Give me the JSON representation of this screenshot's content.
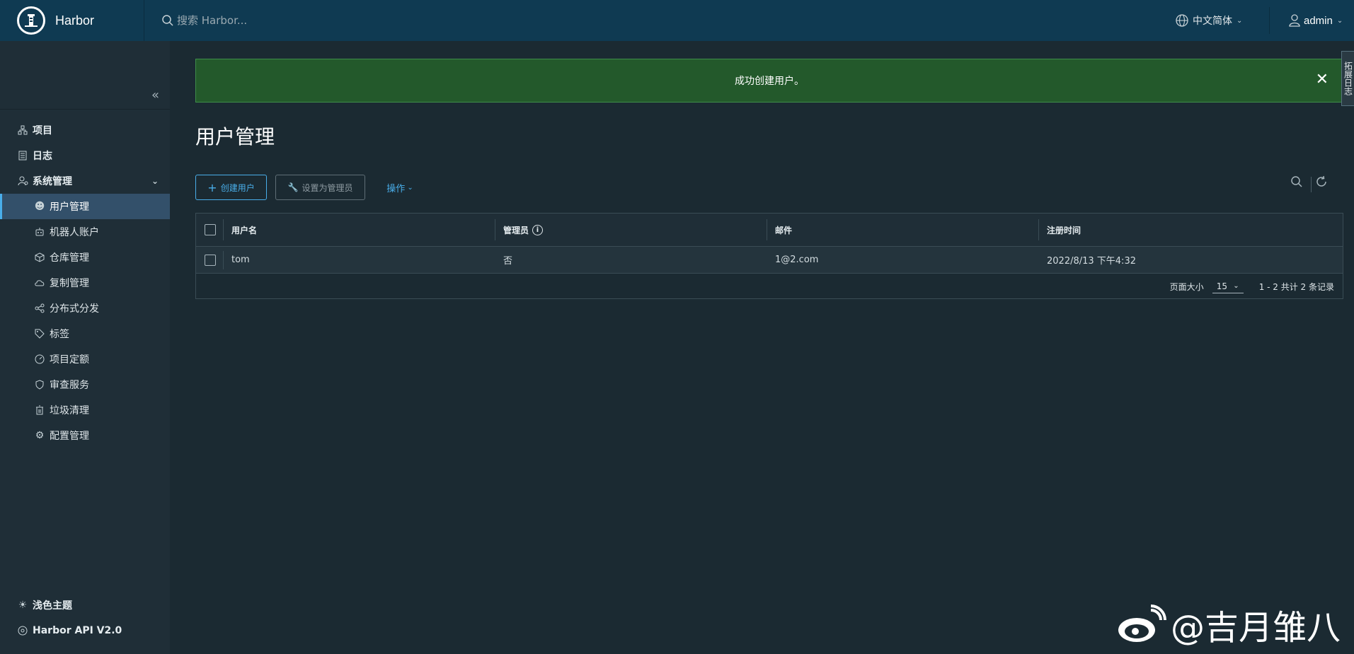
{
  "header": {
    "brand": "Harbor",
    "search_placeholder": "搜索 Harbor...",
    "language": "中文简体",
    "user": "admin"
  },
  "sidebar": {
    "items": [
      {
        "label": "项目",
        "icon": "project-icon"
      },
      {
        "label": "日志",
        "icon": "log-icon"
      },
      {
        "label": "系统管理",
        "icon": "admin-icon"
      }
    ],
    "sub_items": [
      {
        "label": "用户管理",
        "icon": "users-icon"
      },
      {
        "label": "机器人账户",
        "icon": "robot-icon"
      },
      {
        "label": "仓库管理",
        "icon": "box-icon"
      },
      {
        "label": "复制管理",
        "icon": "cloud-icon"
      },
      {
        "label": "分布式分发",
        "icon": "share-icon"
      },
      {
        "label": "标签",
        "icon": "tag-icon"
      },
      {
        "label": "项目定额",
        "icon": "dashboard-icon"
      },
      {
        "label": "审查服务",
        "icon": "shield-icon"
      },
      {
        "label": "垃圾清理",
        "icon": "trash-icon"
      },
      {
        "label": "配置管理",
        "icon": "gear-icon"
      }
    ],
    "footer": {
      "theme": "浅色主题",
      "api": "Harbor API V2.0"
    }
  },
  "alert": {
    "message": "成功创建用户。",
    "side_tab": "拓展日志"
  },
  "page": {
    "title": "用户管理"
  },
  "toolbar": {
    "create_label": "创建用户",
    "set_admin_label": "设置为管理员",
    "action_label": "操作"
  },
  "table": {
    "headers": [
      "用户名",
      "管理员",
      "邮件",
      "注册时间"
    ],
    "rows": [
      {
        "username": "tom",
        "admin": "否",
        "email": "1@2.com",
        "registered": "2022/8/13 下午4:32"
      }
    ],
    "footer": {
      "page_size_label": "页面大小",
      "page_size": "15",
      "summary": "1 - 2 共计 2 条记录"
    }
  },
  "watermark": "@吉月雏八",
  "colors": {
    "header_bg": "#0f3a52",
    "accent": "#49aeea",
    "alert_bg": "#23592b",
    "sidebar_bg": "#1f2e37",
    "content_bg": "#1b2a32"
  }
}
